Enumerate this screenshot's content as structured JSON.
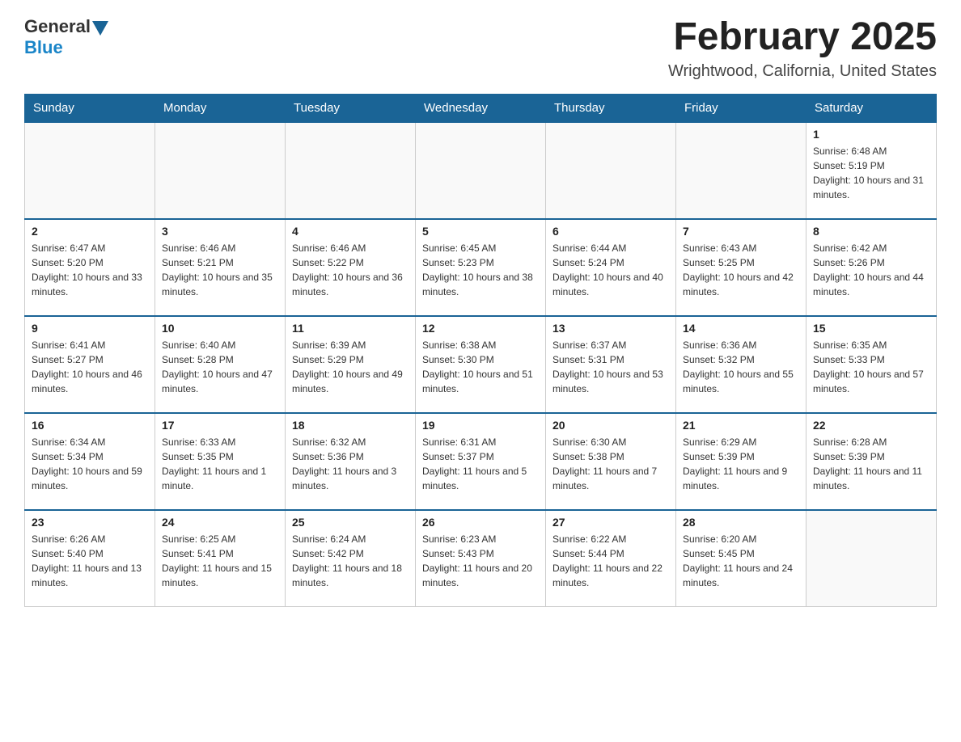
{
  "header": {
    "logo": {
      "text1": "General",
      "text2": "Blue"
    },
    "title": "February 2025",
    "location": "Wrightwood, California, United States"
  },
  "days_of_week": [
    "Sunday",
    "Monday",
    "Tuesday",
    "Wednesday",
    "Thursday",
    "Friday",
    "Saturday"
  ],
  "weeks": [
    [
      {
        "day": null,
        "info": null
      },
      {
        "day": null,
        "info": null
      },
      {
        "day": null,
        "info": null
      },
      {
        "day": null,
        "info": null
      },
      {
        "day": null,
        "info": null
      },
      {
        "day": null,
        "info": null
      },
      {
        "day": "1",
        "info": "Sunrise: 6:48 AM\nSunset: 5:19 PM\nDaylight: 10 hours and 31 minutes."
      }
    ],
    [
      {
        "day": "2",
        "info": "Sunrise: 6:47 AM\nSunset: 5:20 PM\nDaylight: 10 hours and 33 minutes."
      },
      {
        "day": "3",
        "info": "Sunrise: 6:46 AM\nSunset: 5:21 PM\nDaylight: 10 hours and 35 minutes."
      },
      {
        "day": "4",
        "info": "Sunrise: 6:46 AM\nSunset: 5:22 PM\nDaylight: 10 hours and 36 minutes."
      },
      {
        "day": "5",
        "info": "Sunrise: 6:45 AM\nSunset: 5:23 PM\nDaylight: 10 hours and 38 minutes."
      },
      {
        "day": "6",
        "info": "Sunrise: 6:44 AM\nSunset: 5:24 PM\nDaylight: 10 hours and 40 minutes."
      },
      {
        "day": "7",
        "info": "Sunrise: 6:43 AM\nSunset: 5:25 PM\nDaylight: 10 hours and 42 minutes."
      },
      {
        "day": "8",
        "info": "Sunrise: 6:42 AM\nSunset: 5:26 PM\nDaylight: 10 hours and 44 minutes."
      }
    ],
    [
      {
        "day": "9",
        "info": "Sunrise: 6:41 AM\nSunset: 5:27 PM\nDaylight: 10 hours and 46 minutes."
      },
      {
        "day": "10",
        "info": "Sunrise: 6:40 AM\nSunset: 5:28 PM\nDaylight: 10 hours and 47 minutes."
      },
      {
        "day": "11",
        "info": "Sunrise: 6:39 AM\nSunset: 5:29 PM\nDaylight: 10 hours and 49 minutes."
      },
      {
        "day": "12",
        "info": "Sunrise: 6:38 AM\nSunset: 5:30 PM\nDaylight: 10 hours and 51 minutes."
      },
      {
        "day": "13",
        "info": "Sunrise: 6:37 AM\nSunset: 5:31 PM\nDaylight: 10 hours and 53 minutes."
      },
      {
        "day": "14",
        "info": "Sunrise: 6:36 AM\nSunset: 5:32 PM\nDaylight: 10 hours and 55 minutes."
      },
      {
        "day": "15",
        "info": "Sunrise: 6:35 AM\nSunset: 5:33 PM\nDaylight: 10 hours and 57 minutes."
      }
    ],
    [
      {
        "day": "16",
        "info": "Sunrise: 6:34 AM\nSunset: 5:34 PM\nDaylight: 10 hours and 59 minutes."
      },
      {
        "day": "17",
        "info": "Sunrise: 6:33 AM\nSunset: 5:35 PM\nDaylight: 11 hours and 1 minute."
      },
      {
        "day": "18",
        "info": "Sunrise: 6:32 AM\nSunset: 5:36 PM\nDaylight: 11 hours and 3 minutes."
      },
      {
        "day": "19",
        "info": "Sunrise: 6:31 AM\nSunset: 5:37 PM\nDaylight: 11 hours and 5 minutes."
      },
      {
        "day": "20",
        "info": "Sunrise: 6:30 AM\nSunset: 5:38 PM\nDaylight: 11 hours and 7 minutes."
      },
      {
        "day": "21",
        "info": "Sunrise: 6:29 AM\nSunset: 5:39 PM\nDaylight: 11 hours and 9 minutes."
      },
      {
        "day": "22",
        "info": "Sunrise: 6:28 AM\nSunset: 5:39 PM\nDaylight: 11 hours and 11 minutes."
      }
    ],
    [
      {
        "day": "23",
        "info": "Sunrise: 6:26 AM\nSunset: 5:40 PM\nDaylight: 11 hours and 13 minutes."
      },
      {
        "day": "24",
        "info": "Sunrise: 6:25 AM\nSunset: 5:41 PM\nDaylight: 11 hours and 15 minutes."
      },
      {
        "day": "25",
        "info": "Sunrise: 6:24 AM\nSunset: 5:42 PM\nDaylight: 11 hours and 18 minutes."
      },
      {
        "day": "26",
        "info": "Sunrise: 6:23 AM\nSunset: 5:43 PM\nDaylight: 11 hours and 20 minutes."
      },
      {
        "day": "27",
        "info": "Sunrise: 6:22 AM\nSunset: 5:44 PM\nDaylight: 11 hours and 22 minutes."
      },
      {
        "day": "28",
        "info": "Sunrise: 6:20 AM\nSunset: 5:45 PM\nDaylight: 11 hours and 24 minutes."
      },
      {
        "day": null,
        "info": null
      }
    ]
  ]
}
